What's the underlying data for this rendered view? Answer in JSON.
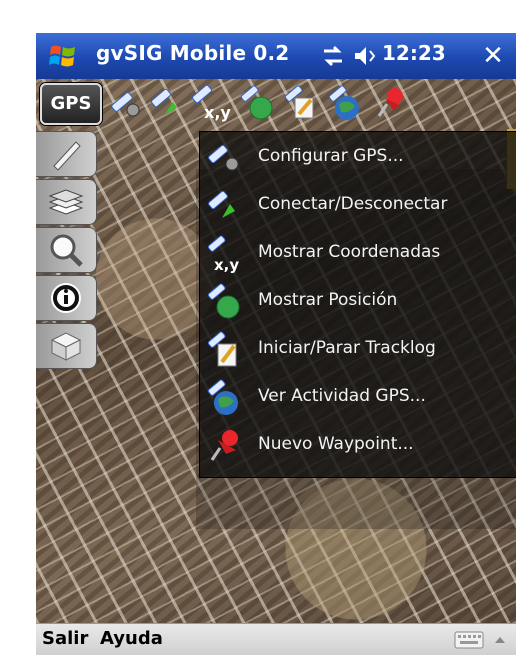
{
  "titlebar": {
    "app_title": "gvSIG Mobile 0.2",
    "time": "12:23",
    "close_label": "✕"
  },
  "toolbar": {
    "gps_label": "GPS",
    "icons": [
      "gps-config-icon",
      "gps-connect-icon",
      "coordinates-icon",
      "show-position-icon",
      "tracklog-icon",
      "gps-activity-icon",
      "waypoint-icon"
    ]
  },
  "side_tools": [
    "pencil-icon",
    "layers-icon",
    "zoom-icon",
    "info-icon",
    "map-3d-icon"
  ],
  "menu": {
    "items": [
      {
        "label": "Configurar GPS...",
        "icon": "gps-config-icon"
      },
      {
        "label": "Conectar/Desconectar",
        "icon": "gps-connect-icon"
      },
      {
        "label": "Mostrar Coordenadas",
        "icon": "coordinates-icon"
      },
      {
        "label": "Mostrar Posición",
        "icon": "show-position-icon"
      },
      {
        "label": "Iniciar/Parar Tracklog",
        "icon": "tracklog-icon"
      },
      {
        "label": "Ver Actividad GPS...",
        "icon": "gps-activity-icon"
      },
      {
        "label": "Nuevo Waypoint...",
        "icon": "waypoint-icon"
      }
    ]
  },
  "icon_text": {
    "xy": "x,y"
  },
  "bottombar": {
    "left_softkey": "Salir",
    "right_softkey": "Ayuda"
  },
  "colors": {
    "title_bar": "#1d49b1",
    "accent_gold": "#c9a03b"
  }
}
